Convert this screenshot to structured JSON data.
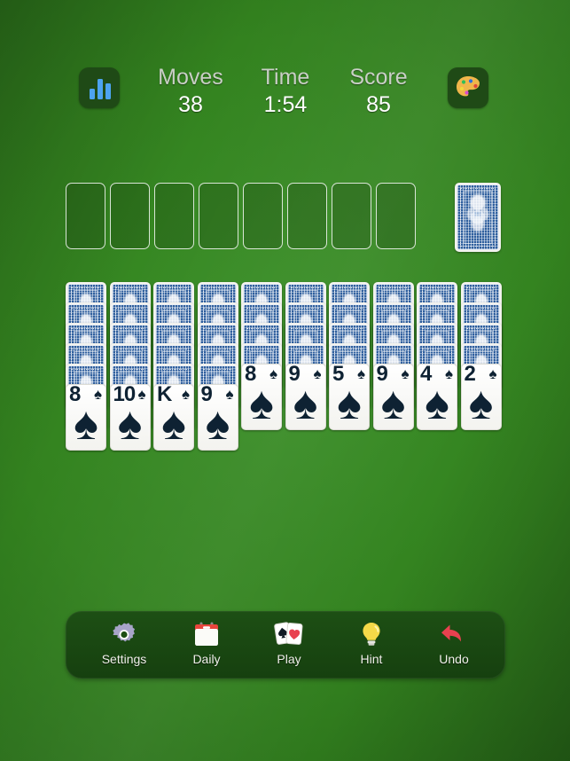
{
  "header": {
    "stats_icon": "bar-chart-icon",
    "theme_icon": "palette-icon",
    "stats": [
      {
        "label": "Moves",
        "value": "38"
      },
      {
        "label": "Time",
        "value": "1:54"
      },
      {
        "label": "Score",
        "value": "85"
      }
    ]
  },
  "foundations": {
    "count": 8,
    "slots": [
      "",
      "",
      "",
      "",
      "",
      "",
      "",
      ""
    ]
  },
  "stock": {
    "facedown": true,
    "card_back": "blue-ornate"
  },
  "tableau": {
    "columns": [
      {
        "facedown": 5,
        "faceup": [
          {
            "rank": "8",
            "suit": "♠"
          }
        ]
      },
      {
        "facedown": 5,
        "faceup": [
          {
            "rank": "10",
            "suit": "♠"
          }
        ]
      },
      {
        "facedown": 5,
        "faceup": [
          {
            "rank": "K",
            "suit": "♠"
          }
        ]
      },
      {
        "facedown": 5,
        "faceup": [
          {
            "rank": "9",
            "suit": "♠"
          }
        ]
      },
      {
        "facedown": 4,
        "faceup": [
          {
            "rank": "8",
            "suit": "♠"
          }
        ]
      },
      {
        "facedown": 4,
        "faceup": [
          {
            "rank": "9",
            "suit": "♠"
          }
        ]
      },
      {
        "facedown": 4,
        "faceup": [
          {
            "rank": "5",
            "suit": "♠"
          }
        ]
      },
      {
        "facedown": 4,
        "faceup": [
          {
            "rank": "9",
            "suit": "♠"
          }
        ]
      },
      {
        "facedown": 4,
        "faceup": [
          {
            "rank": "4",
            "suit": "♠"
          }
        ]
      },
      {
        "facedown": 4,
        "faceup": [
          {
            "rank": "2",
            "suit": "♠"
          }
        ]
      }
    ]
  },
  "toolbar": {
    "items": [
      {
        "label": "Settings",
        "icon": "gear-icon"
      },
      {
        "label": "Daily",
        "icon": "calendar-icon"
      },
      {
        "label": "Play",
        "icon": "playing-cards-icon"
      },
      {
        "label": "Hint",
        "icon": "lightbulb-icon"
      },
      {
        "label": "Undo",
        "icon": "undo-arrow-icon"
      }
    ]
  },
  "colors": {
    "felt_light": "#3a8f27",
    "felt_dark": "#1d5412",
    "card_back_blue": "#2f5f9e",
    "pip_color": "#0e2233",
    "toolbar_bg": "#1d4f14",
    "undo_red": "#e8414f",
    "hint_yellow": "#f5d948",
    "daily_red": "#e8453c",
    "gear_purple": "#a7a4c8"
  }
}
